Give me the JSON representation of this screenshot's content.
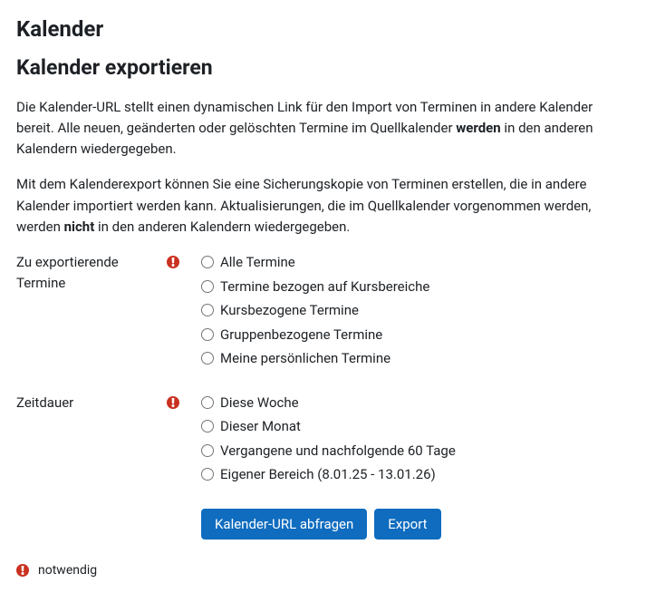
{
  "page_title": "Kalender",
  "section_title": "Kalender exportieren",
  "paragraphs": {
    "p1_pre": "Die Kalender-URL stellt einen dynamischen Link für den Import von Terminen in andere Kalender bereit. Alle neuen, geänderten oder gelöschten Termine im Quellkalender ",
    "p1_bold": "werden",
    "p1_post": " in den anderen Kalendern wiedergegeben.",
    "p2_pre": "Mit dem Kalenderexport können Sie eine Sicherungskopie von Terminen erstellen, die in andere Kalender importiert werden kann. Aktualisierungen, die im Quellkalender vorgenommen werden, werden ",
    "p2_bold": "nicht",
    "p2_post": " in den anderen Kalendern wiedergegeben."
  },
  "form": {
    "export_events": {
      "label": "Zu exportierende Termine",
      "options": [
        "Alle Termine",
        "Termine bezogen auf Kursbereiche",
        "Kursbezogene Termine",
        "Gruppenbezogene Termine",
        "Meine persönlichen Termine"
      ]
    },
    "time_period": {
      "label": "Zeitdauer",
      "options": [
        "Diese Woche",
        "Dieser Monat",
        "Vergangene und nachfolgende 60 Tage",
        "Eigener Bereich (8.01.25 - 13.01.26)"
      ]
    }
  },
  "buttons": {
    "get_url": "Kalender-URL abfragen",
    "export": "Export"
  },
  "legend_required": "notwendig"
}
